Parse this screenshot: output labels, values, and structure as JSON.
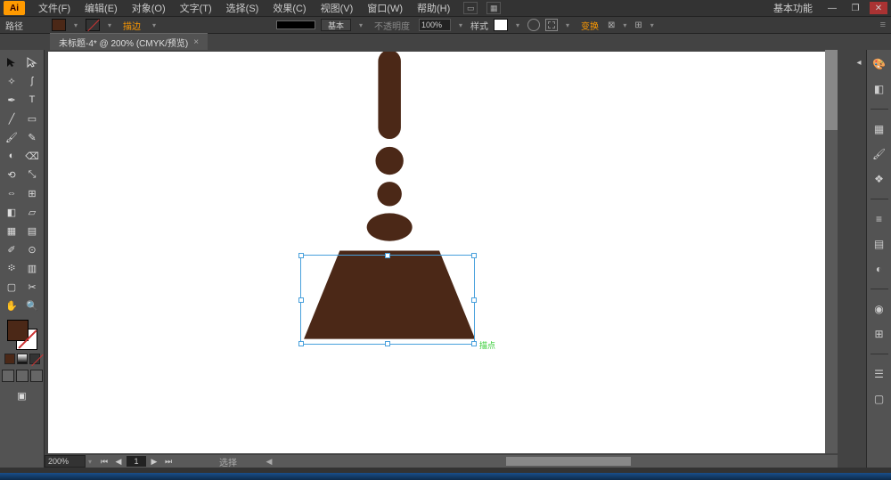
{
  "app": {
    "logo": "Ai"
  },
  "menu": {
    "file": "文件(F)",
    "edit": "编辑(E)",
    "object": "对象(O)",
    "type": "文字(T)",
    "select": "选择(S)",
    "effect": "效果(C)",
    "view": "视图(V)",
    "window": "窗口(W)",
    "help": "帮助(H)"
  },
  "workspace": {
    "label": "基本功能"
  },
  "controlbar": {
    "selection_type": "路径",
    "stroke_label": "描边",
    "stroke_style": "基本",
    "opacity_label": "不透明度",
    "opacity_value": "100%",
    "style_label": "样式",
    "transform_label": "变换"
  },
  "doc_tab": {
    "title": "未标题-4* @ 200% (CMYK/预览)"
  },
  "status": {
    "zoom": "200%",
    "page": "1",
    "selection_label": "选择",
    "smart_guide": "描点"
  },
  "colors": {
    "fill": "#4B2817",
    "accent": "#FF9A00"
  }
}
